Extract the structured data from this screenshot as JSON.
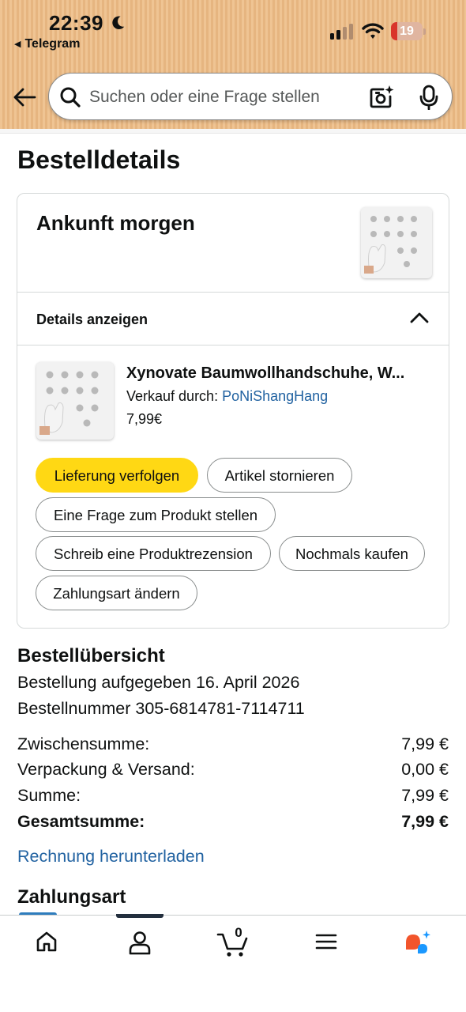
{
  "status_bar": {
    "time": "22:39",
    "back_app": "Telegram",
    "battery_percent": "19",
    "battery_level": 0.19,
    "moon_icon": "moon-icon",
    "signal_icon": "cellular-signal-icon",
    "wifi_icon": "wifi-icon"
  },
  "header": {
    "back_icon": "arrow-left-icon",
    "search": {
      "placeholder": "Suchen oder eine Frage stellen",
      "search_icon": "search-icon",
      "camera_icon": "camera-sparkle-icon",
      "mic_icon": "microphone-icon"
    },
    "colors": {
      "background": "#efc493"
    }
  },
  "page": {
    "title": "Bestelldetails"
  },
  "shipment": {
    "arrival": "Ankunft morgen",
    "details_toggle": "Details anzeigen",
    "details_expanded": true,
    "item": {
      "title": "Xynovate Baumwollhandschuhe, W...",
      "seller_prefix": "Verkauf durch:",
      "seller_name": "PoNiShangHang",
      "price": "7,99€"
    },
    "actions": {
      "track": "Lieferung verfolgen",
      "cancel": "Artikel stornieren",
      "question": "Eine Frage zum Produkt stellen",
      "review": "Schreib eine Produktrezension",
      "buy_again": "Nochmals kaufen",
      "change_payment": "Zahlungsart ändern"
    }
  },
  "summary": {
    "heading": "Bestellübersicht",
    "placed": "Bestellung aufgegeben 16. April 2026",
    "order_number": "Bestellnummer 305-6814781-7114711",
    "rows": [
      {
        "label": "Zwischensumme:",
        "value": "7,99 €"
      },
      {
        "label": "Verpackung & Versand:",
        "value": "0,00 €"
      },
      {
        "label": "Summe:",
        "value": "7,99 €"
      },
      {
        "label": "Gesamtsumme:",
        "value": "7,99 €"
      }
    ],
    "invoice_link": "Rechnung herunterladen"
  },
  "payment": {
    "heading": "Zahlungsart"
  },
  "bottom_nav": {
    "items": [
      {
        "name": "home",
        "icon": "home-icon"
      },
      {
        "name": "account",
        "icon": "user-icon"
      },
      {
        "name": "cart",
        "icon": "cart-icon",
        "count": "0"
      },
      {
        "name": "menu",
        "icon": "hamburger-menu-icon"
      },
      {
        "name": "rufus",
        "icon": "rufus-ai-icon"
      }
    ],
    "active": "account"
  },
  "colors": {
    "primary_button": "#ffd814",
    "link": "#2162a1",
    "battery_low": "#d9342b",
    "text": "#0f1111"
  }
}
